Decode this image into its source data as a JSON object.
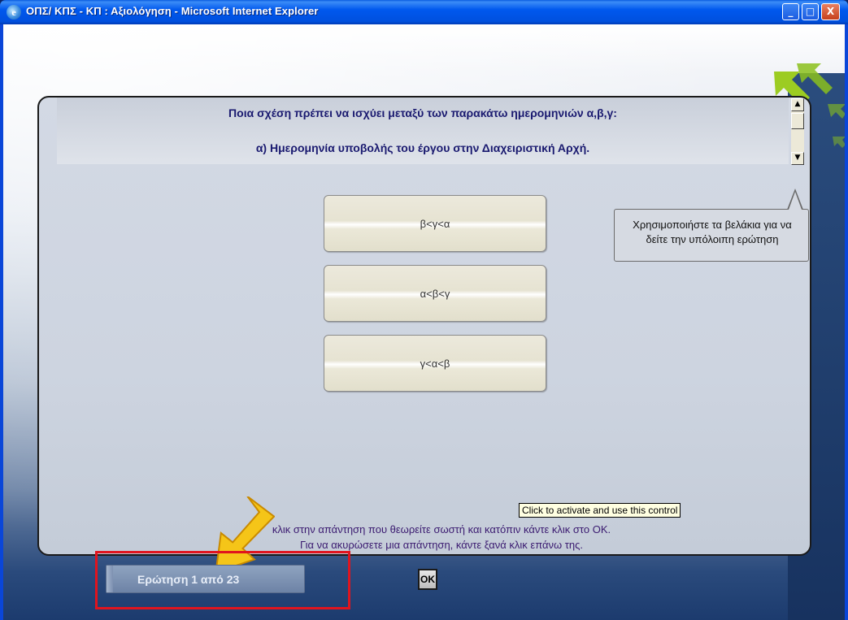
{
  "window": {
    "title": "ΟΠΣ/ ΚΠΣ - ΚΠ : Αξιολόγηση - Microsoft Internet Explorer",
    "ie_icon": "ie-icon",
    "ie_glyph": "e",
    "minimize_glyph": "_",
    "maximize_glyph": "□",
    "close_glyph": "X"
  },
  "question": {
    "line1": "Ποια σχέση πρέπει να ισχύει μεταξύ των παρακάτω ημερομηνιών α,β,γ:",
    "line2": "α) Ημερομηνία υποβολής του έργου στην Διαχειριστική Αρχή.",
    "scroll_up_glyph": "▲",
    "scroll_down_glyph": "▼"
  },
  "answers": [
    {
      "label": "β<γ<α"
    },
    {
      "label": "α<β<γ"
    },
    {
      "label": "γ<α<β"
    }
  ],
  "hint": {
    "text": "Χρησιμοποιήστε τα βελάκια για να δείτε την υπόλοιπη ερώτηση"
  },
  "instructions": {
    "line1": "κλικ στην απάντηση που θεωρείτε σωστή και κατόπιν κάντε κλικ στο ΟΚ.",
    "line2": "Για να ακυρώσετε μια απάντηση, κάντε ξανά κλικ επάνω της."
  },
  "tooltip": {
    "text": "Click to activate and use this control"
  },
  "footer": {
    "counter": "Ερώτηση 1 από 23",
    "ok_label": "OK"
  },
  "colors": {
    "question_text": "#1a1a70",
    "instruction_text": "#3a1a70",
    "highlight_border": "#e0141e",
    "arrow_fill": "#f5c518"
  }
}
